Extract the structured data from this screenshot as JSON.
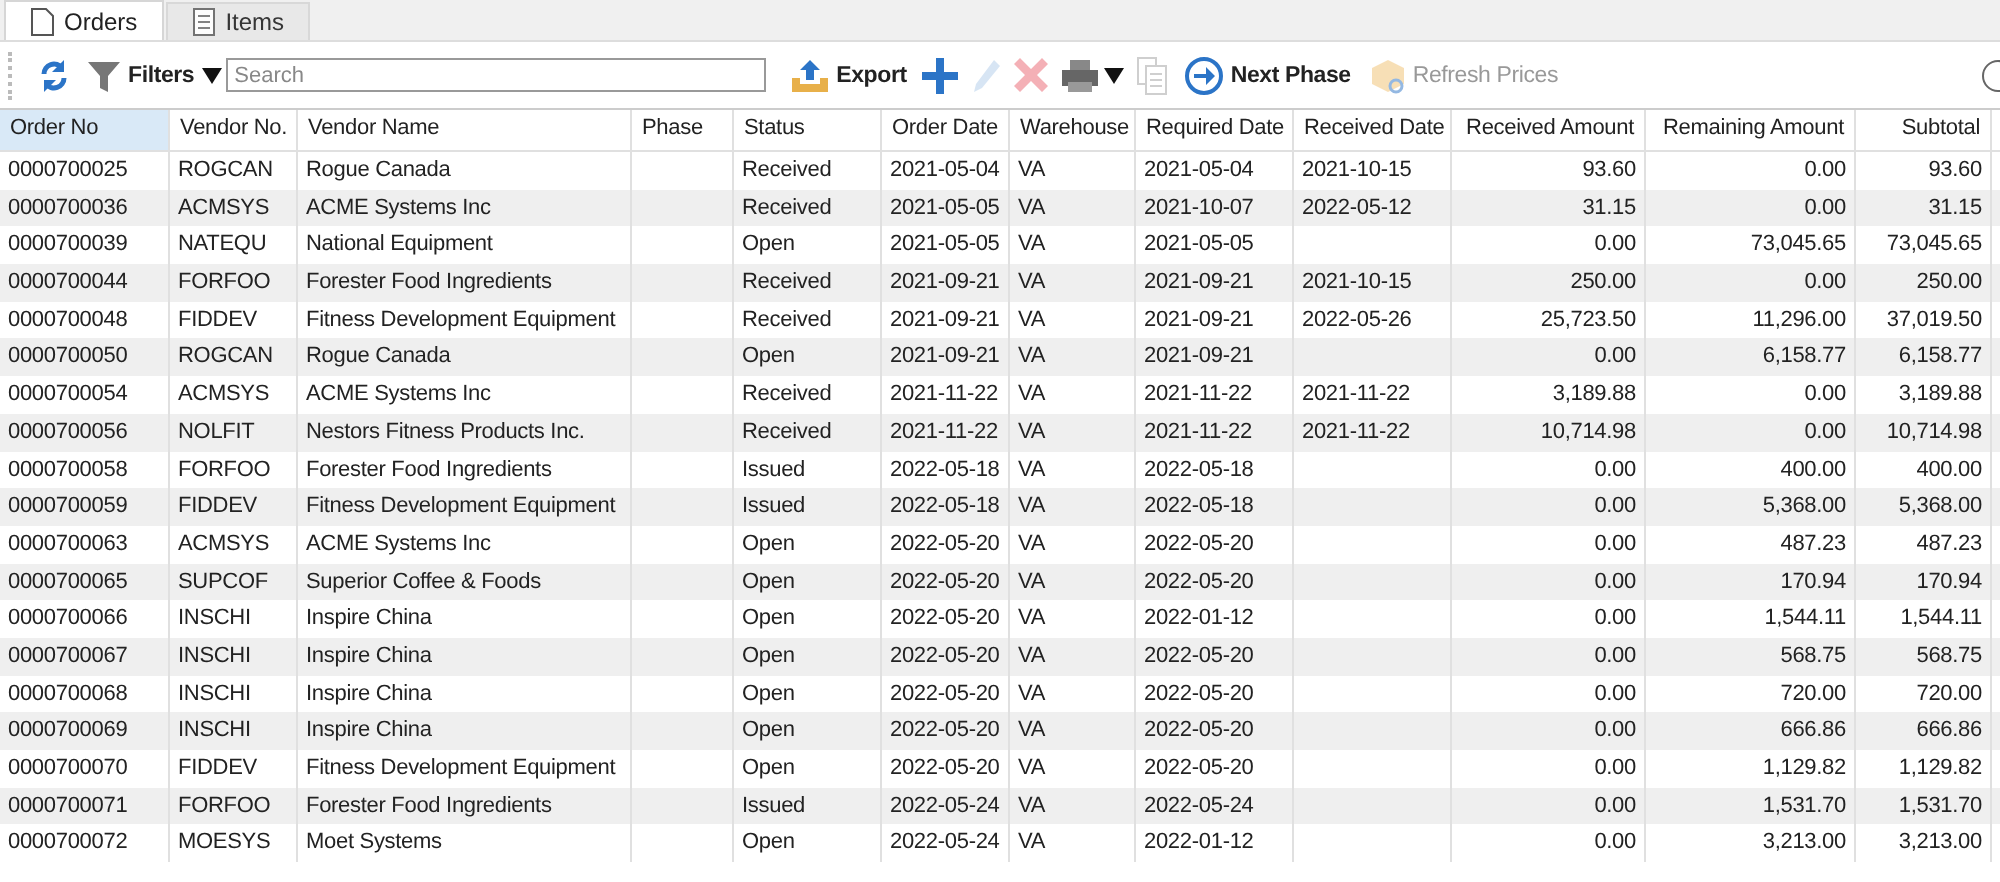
{
  "tabs": [
    {
      "label": "Orders",
      "selected": true
    },
    {
      "label": "Items",
      "selected": false
    }
  ],
  "toolbar": {
    "filters": {
      "label": "Filters"
    },
    "search": {
      "placeholder": "Search"
    },
    "buttons": [
      {
        "kind": "export",
        "label": "Export",
        "disabled": false
      },
      {
        "kind": "add",
        "disabled": false
      },
      {
        "kind": "edit",
        "disabled": true
      },
      {
        "kind": "delete",
        "disabled": true
      },
      {
        "kind": "print",
        "disabled": false
      },
      {
        "kind": "copy",
        "disabled": true
      },
      {
        "kind": "next",
        "label": "Next Phase",
        "disabled": false
      },
      {
        "kind": "prices",
        "label": "Refresh Prices",
        "disabled": true
      }
    ]
  },
  "table": {
    "columns": [
      {
        "label": "Order No",
        "kind": "text",
        "selected": true
      },
      {
        "label": "Vendor No.",
        "kind": "text",
        "selected": false
      },
      {
        "label": "Vendor Name",
        "kind": "text",
        "selected": false
      },
      {
        "label": "Phase",
        "kind": "text",
        "selected": false
      },
      {
        "label": "Status",
        "kind": "text",
        "selected": false
      },
      {
        "label": "Order Date",
        "kind": "text",
        "selected": false
      },
      {
        "label": "Warehouse",
        "kind": "text",
        "selected": false
      },
      {
        "label": "Required Date",
        "kind": "text",
        "selected": false
      },
      {
        "label": "Received Date",
        "kind": "text",
        "selected": false
      },
      {
        "label": "Received Amount",
        "kind": "amount",
        "selected": false
      },
      {
        "label": "Remaining Amount",
        "kind": "amount",
        "selected": false
      },
      {
        "label": "Subtotal",
        "kind": "amount",
        "selected": false
      }
    ],
    "rows": [
      [
        "0000700025",
        "ROGCAN",
        "Rogue Canada",
        null,
        "Received",
        "2021-05-04",
        "VA",
        "2021-05-04",
        "2021-10-15",
        "93.60",
        "0.00",
        "93.60"
      ],
      [
        "0000700036",
        "ACMSYS",
        "ACME Systems Inc",
        null,
        "Received",
        "2021-05-05",
        "VA",
        "2021-10-07",
        "2022-05-12",
        "31.15",
        "0.00",
        "31.15"
      ],
      [
        "0000700039",
        "NATEQU",
        "National Equipment",
        null,
        "Open",
        "2021-05-05",
        "VA",
        "2021-05-05",
        null,
        "0.00",
        "73,045.65",
        "73,045.65"
      ],
      [
        "0000700044",
        "FORFOO",
        "Forester Food Ingredients",
        null,
        "Received",
        "2021-09-21",
        "VA",
        "2021-09-21",
        "2021-10-15",
        "250.00",
        "0.00",
        "250.00"
      ],
      [
        "0000700048",
        "FIDDEV",
        "Fitness Development Equipment",
        null,
        "Received",
        "2021-09-21",
        "VA",
        "2021-09-21",
        "2022-05-26",
        "25,723.50",
        "11,296.00",
        "37,019.50"
      ],
      [
        "0000700050",
        "ROGCAN",
        "Rogue Canada",
        null,
        "Open",
        "2021-09-21",
        "VA",
        "2021-09-21",
        null,
        "0.00",
        "6,158.77",
        "6,158.77"
      ],
      [
        "0000700054",
        "ACMSYS",
        "ACME Systems Inc",
        null,
        "Received",
        "2021-11-22",
        "VA",
        "2021-11-22",
        "2021-11-22",
        "3,189.88",
        "0.00",
        "3,189.88"
      ],
      [
        "0000700056",
        "NOLFIT",
        "Nestors Fitness Products Inc.",
        null,
        "Received",
        "2021-11-22",
        "VA",
        "2021-11-22",
        "2021-11-22",
        "10,714.98",
        "0.00",
        "10,714.98"
      ],
      [
        "0000700058",
        "FORFOO",
        "Forester Food Ingredients",
        null,
        "Issued",
        "2022-05-18",
        "VA",
        "2022-05-18",
        null,
        "0.00",
        "400.00",
        "400.00"
      ],
      [
        "0000700059",
        "FIDDEV",
        "Fitness Development Equipment",
        null,
        "Issued",
        "2022-05-18",
        "VA",
        "2022-05-18",
        null,
        "0.00",
        "5,368.00",
        "5,368.00"
      ],
      [
        "0000700063",
        "ACMSYS",
        "ACME Systems Inc",
        null,
        "Open",
        "2022-05-20",
        "VA",
        "2022-05-20",
        null,
        "0.00",
        "487.23",
        "487.23"
      ],
      [
        "0000700065",
        "SUPCOF",
        "Superior Coffee & Foods",
        null,
        "Open",
        "2022-05-20",
        "VA",
        "2022-05-20",
        null,
        "0.00",
        "170.94",
        "170.94"
      ],
      [
        "0000700066",
        "INSCHI",
        "Inspire China",
        null,
        "Open",
        "2022-05-20",
        "VA",
        "2022-01-12",
        null,
        "0.00",
        "1,544.11",
        "1,544.11"
      ],
      [
        "0000700067",
        "INSCHI",
        "Inspire China",
        null,
        "Open",
        "2022-05-20",
        "VA",
        "2022-05-20",
        null,
        "0.00",
        "568.75",
        "568.75"
      ],
      [
        "0000700068",
        "INSCHI",
        "Inspire China",
        null,
        "Open",
        "2022-05-20",
        "VA",
        "2022-05-20",
        null,
        "0.00",
        "720.00",
        "720.00"
      ],
      [
        "0000700069",
        "INSCHI",
        "Inspire China",
        null,
        "Open",
        "2022-05-20",
        "VA",
        "2022-05-20",
        null,
        "0.00",
        "666.86",
        "666.86"
      ],
      [
        "0000700070",
        "FIDDEV",
        "Fitness Development Equipment",
        null,
        "Open",
        "2022-05-20",
        "VA",
        "2022-05-20",
        null,
        "0.00",
        "1,129.82",
        "1,129.82"
      ],
      [
        "0000700071",
        "FORFOO",
        "Forester Food Ingredients",
        null,
        "Issued",
        "2022-05-24",
        "VA",
        "2022-05-24",
        null,
        "0.00",
        "1,531.70",
        "1,531.70"
      ],
      [
        "0000700072",
        "MOESYS",
        "Moet Systems",
        null,
        "Open",
        "2022-05-24",
        "VA",
        "2022-01-12",
        null,
        "0.00",
        "3,213.00",
        "3,213.00"
      ]
    ]
  }
}
